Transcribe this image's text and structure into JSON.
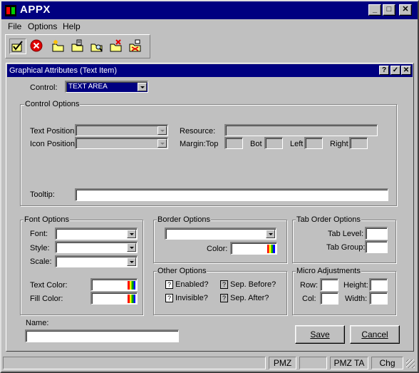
{
  "app": {
    "title": "APPX"
  },
  "menu": {
    "items": [
      "File",
      "Options",
      "Help"
    ]
  },
  "titlebar_buttons": {
    "minimize": "_",
    "maximize": "□",
    "close": "✕"
  },
  "toolbar": {
    "tools": [
      "check-edit-icon",
      "cancel-icon",
      "folder-new-icon",
      "folder-edit-icon",
      "folder-search-icon",
      "folder-delete-icon",
      "folder-cancel-icon"
    ]
  },
  "dialog": {
    "title": "Graphical Attributes (Text Item)",
    "buttons": {
      "help": "?",
      "ok": "✓",
      "close": "✕"
    },
    "control": {
      "label": "Control:",
      "value": "TEXT AREA"
    },
    "control_options": {
      "title": "Control Options",
      "text_position_label": "Text Position:",
      "icon_position_label": "Icon Position:",
      "resource_label": "Resource:",
      "margin_top_label": "Margin:Top",
      "bot_label": "Bot",
      "left_label": "Left",
      "right_label": "Right",
      "tooltip_label": "Tooltip:"
    },
    "font_options": {
      "title": "Font Options",
      "font_label": "Font:",
      "style_label": "Style:",
      "scale_label": "Scale:",
      "text_color_label": "Text Color:",
      "fill_color_label": "Fill Color:"
    },
    "border_options": {
      "title": "Border Options",
      "color_label": "Color:"
    },
    "tab_order_options": {
      "title": "Tab Order Options",
      "tab_level_label": "Tab Level:",
      "tab_group_label": "Tab Group:"
    },
    "other_options": {
      "title": "Other Options",
      "enabled_label": "Enabled?",
      "invisible_label": "Invisible?",
      "sep_before_label": "Sep. Before?",
      "sep_after_label": "Sep. After?",
      "check_glyph": "?"
    },
    "micro_adjustments": {
      "title": "Micro Adjustments",
      "row_label": "Row:",
      "height_label": "Height:",
      "col_label": "Col:",
      "width_label": "Width:"
    },
    "name_label": "Name:",
    "save_button": "Save",
    "cancel_button": "Cancel"
  },
  "statusbar": {
    "cells": [
      "",
      "PMZ",
      "",
      "PMZ TA",
      "Chg"
    ]
  },
  "colors": {
    "title_bar": "#000080",
    "face": "#c0c0c0",
    "field": "#ffffff"
  }
}
